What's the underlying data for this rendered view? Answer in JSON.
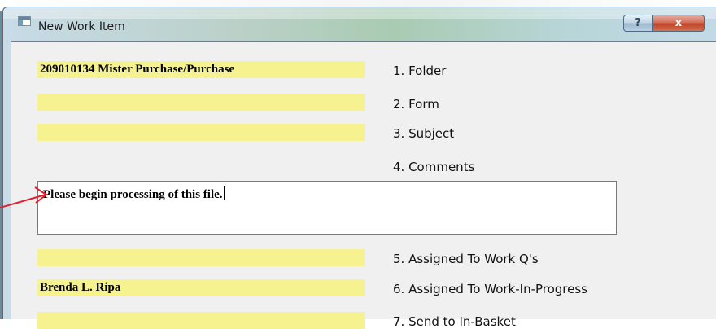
{
  "window": {
    "title": "New Work Item",
    "help_button": "?",
    "close_button": "x"
  },
  "fields": {
    "folder_value": "209010134 Mister Purchase/Purchase",
    "form_value": "",
    "subject_value": "",
    "comments_value": "Please begin processing of this file.",
    "assigned_queues_value": "",
    "assigned_wip_value": "Brenda L. Ripa",
    "send_to_basket_value": ""
  },
  "labels": {
    "folder": "1. Folder",
    "form": "2. Form",
    "subject": "3. Subject",
    "comments": "4. Comments",
    "assigned_queues": "5. Assigned To Work Q's",
    "assigned_wip": "6. Assigned To Work-In-Progress",
    "send_to_basket": "7. Send to In-Basket"
  },
  "colors": {
    "field_highlight": "#f5f28f",
    "annotation_arrow": "#e0202e"
  }
}
